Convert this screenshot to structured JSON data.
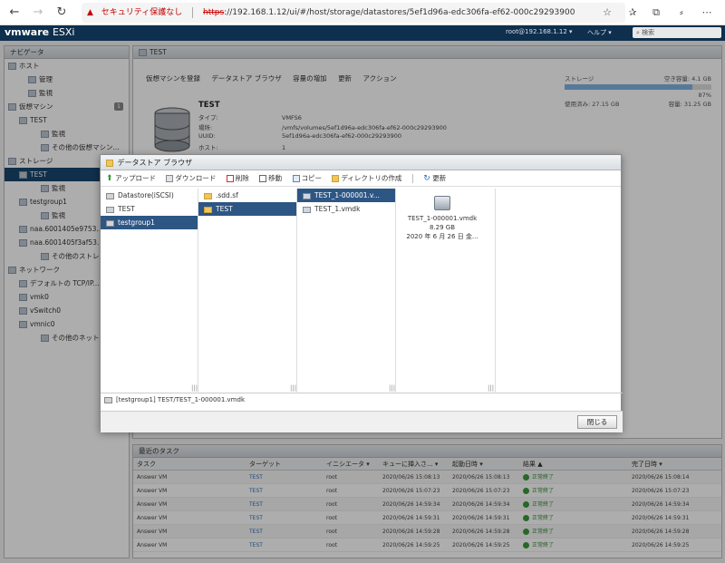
{
  "browser": {
    "warning": "セキュリティ保護なし",
    "url_scheme": "https",
    "url_rest": "://192.168.1.12/ui/#/host/storage/datastores/5ef1d96a-edc306fa-ef62-000c29293900"
  },
  "esx": {
    "logo_vm": "vmware",
    "logo_esxi": "ESXi",
    "user": "root@192.168.1.12 ▾",
    "help": "ヘルプ ▾",
    "search_placeholder": "検索"
  },
  "navigator": {
    "title": "ナビゲータ",
    "items": [
      {
        "label": "ホスト",
        "indent": 4
      },
      {
        "label": "管理",
        "indent": 26
      },
      {
        "label": "監視",
        "indent": 26
      },
      {
        "label": "仮想マシン",
        "indent": 4,
        "badge": "1"
      },
      {
        "label": "TEST",
        "indent": 16
      },
      {
        "label": "監視",
        "indent": 40
      },
      {
        "label": "その他の仮想マシン...",
        "indent": 40
      },
      {
        "label": "ストレージ",
        "indent": 4
      },
      {
        "label": "TEST",
        "indent": 16,
        "selected": true
      },
      {
        "label": "監視",
        "indent": 40
      },
      {
        "label": "testgroup1",
        "indent": 16
      },
      {
        "label": "監視",
        "indent": 40
      },
      {
        "label": "naa.6001405e9753...",
        "indent": 16
      },
      {
        "label": "naa.6001405f3af53...",
        "indent": 16
      },
      {
        "label": "その他のストレージ",
        "indent": 40
      },
      {
        "label": "ネットワーク",
        "indent": 4
      },
      {
        "label": "デフォルトの TCP/IP...",
        "indent": 16
      },
      {
        "label": "vmk0",
        "indent": 16
      },
      {
        "label": "vSwitch0",
        "indent": 16
      },
      {
        "label": "vmnic0",
        "indent": 16
      },
      {
        "label": "その他のネットワーク",
        "indent": 40
      }
    ]
  },
  "main": {
    "title": "TEST",
    "toolbar": [
      "仮想マシンを登録",
      "データストア ブラウザ",
      "容量の増加",
      "更新",
      "アクション"
    ],
    "ds_name": "TEST",
    "props": [
      {
        "k": "タイプ:",
        "v": "VMFS6"
      },
      {
        "k": "場所:",
        "v": "/vmfs/volumes/5ef1d96a-edc306fa-ef62-000c29293900"
      },
      {
        "k": "UUID:",
        "v": "5ef1d96a-edc306fa-ef62-000c29293900"
      },
      {
        "k": "ホスト:",
        "v": "1"
      }
    ],
    "capacity": {
      "label": "ストレージ",
      "free": "空き容量: 4.1 GB",
      "percent": "87%",
      "percent_value": 0.87,
      "used": "使用済み: 27.15 GB",
      "total": "容量: 31.25 GB"
    }
  },
  "tasks": {
    "title": "最近のタスク",
    "headers": [
      "タスク",
      "ターゲット",
      "イニシエータ ▾",
      "キューに挿入さ... ▾",
      "起動日時 ▾",
      "結果 ▲",
      "完了日時 ▾"
    ],
    "rows": [
      [
        "Answer VM",
        "TEST",
        "root",
        "2020/06/26 15:08:13",
        "2020/06/26 15:08:13",
        "正常終了",
        "2020/06/26 15:08:14"
      ],
      [
        "Answer VM",
        "TEST",
        "root",
        "2020/06/26 15:07:23",
        "2020/06/26 15:07:23",
        "正常終了",
        "2020/06/26 15:07:23"
      ],
      [
        "Answer VM",
        "TEST",
        "root",
        "2020/06/26 14:59:34",
        "2020/06/26 14:59:34",
        "正常終了",
        "2020/06/26 14:59:34"
      ],
      [
        "Answer VM",
        "TEST",
        "root",
        "2020/06/26 14:59:31",
        "2020/06/26 14:59:31",
        "正常終了",
        "2020/06/26 14:59:31"
      ],
      [
        "Answer VM",
        "TEST",
        "root",
        "2020/06/26 14:59:28",
        "2020/06/26 14:59:28",
        "正常終了",
        "2020/06/26 14:59:28"
      ],
      [
        "Answer VM",
        "TEST",
        "root",
        "2020/06/26 14:59:25",
        "2020/06/26 14:59:25",
        "正常終了",
        "2020/06/26 14:59:25"
      ]
    ]
  },
  "dialog": {
    "title": "データストア ブラウザ",
    "toolbar": {
      "upload": "アップロード",
      "download": "ダウンロード",
      "delete": "削除",
      "move": "移動",
      "copy": "コピー",
      "mkdir": "ディレクトリの作成",
      "refresh": "更新"
    },
    "col1": [
      "Datastore(iSCSI)",
      "TEST",
      "testgroup1"
    ],
    "col2": [
      ".sdd.sf",
      "TEST"
    ],
    "col3": [
      "TEST_1-000001.v...",
      "TEST_1.vmdk"
    ],
    "preview": {
      "name": "TEST_1-000001.vmdk",
      "size": "8.29 GB",
      "date": "2020 年 6 月 26 日 金..."
    },
    "path": "[testgroup1] TEST/TEST_1-000001.vmdk",
    "close": "閉じる"
  }
}
